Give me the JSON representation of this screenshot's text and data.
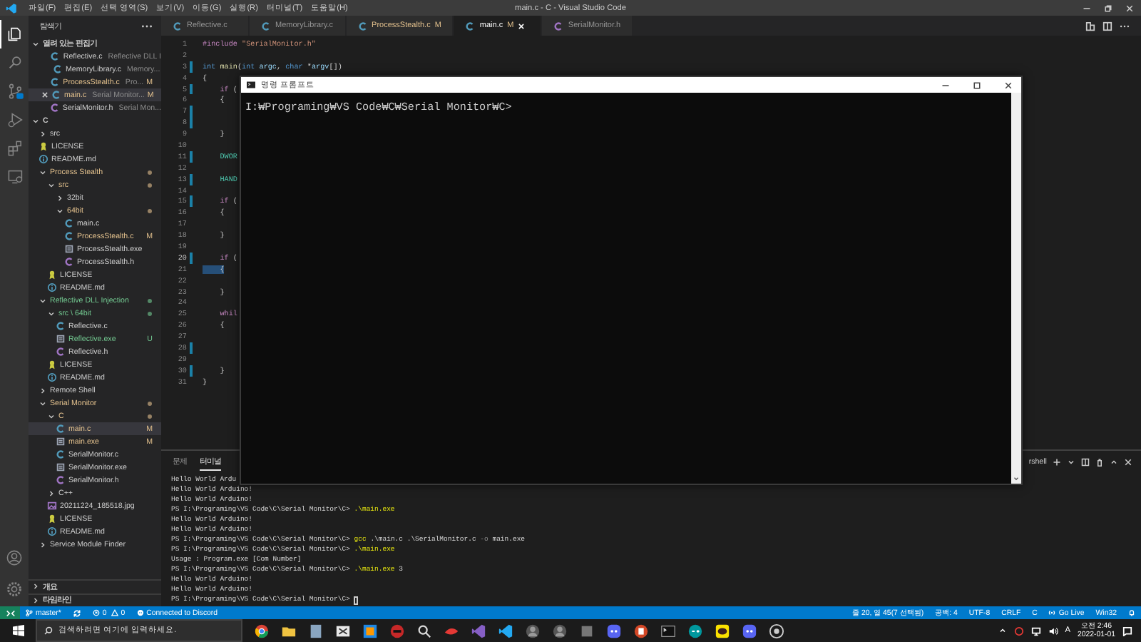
{
  "window": {
    "title": "main.c - C - Visual Studio Code",
    "menu": [
      "파일(F)",
      "편집(E)",
      "선택 영역(S)",
      "보기(V)",
      "이동(G)",
      "실행(R)",
      "터미널(T)",
      "도움말(H)"
    ]
  },
  "activity_bar": [
    {
      "selected": true
    },
    {
      "selected": false
    },
    {
      "selected": false
    },
    {
      "selected": false
    },
    {
      "selected": false
    },
    {
      "selected": false
    }
  ],
  "sidebar": {
    "title": "탐색기",
    "open_editors": {
      "title": "열려 있는 편집기",
      "expanded": true,
      "items": [
        {
          "name": "Reflective.c",
          "kind": "c",
          "description": "Reflective DLL I",
          "selected": false
        },
        {
          "name": "MemoryLibrary.c",
          "kind": "c",
          "description": "Memory...",
          "selected": false
        },
        {
          "name": "ProcessStealth.c",
          "kind": "c",
          "description": "Pro...",
          "badge": "M",
          "modified": true,
          "selected": false
        },
        {
          "name": "main.c",
          "kind": "c",
          "description": "Serial Monitor...",
          "badge": "M",
          "modified": true,
          "selected": true
        },
        {
          "name": "SerialMonitor.h",
          "kind": "h",
          "description": "Serial Mon...",
          "selected": false
        }
      ]
    },
    "folder": {
      "title": "C",
      "expanded": true,
      "tree": [
        {
          "label": "src",
          "kind": "folder",
          "expanded": false,
          "selected": false
        },
        {
          "label": "LICENSE",
          "kind": "license",
          "selected": false
        },
        {
          "label": "README.md",
          "kind": "md",
          "selected": false
        },
        {
          "label": "Process Stealth",
          "kind": "folder",
          "expanded": true,
          "modified": true,
          "selected": false,
          "children": [
            {
              "label": "src",
              "kind": "folder",
              "expanded": true,
              "modified": true,
              "selected": false,
              "children": [
                {
                  "label": "32bit",
                  "kind": "folder",
                  "expanded": false,
                  "selected": false
                },
                {
                  "label": "64bit",
                  "kind": "folder",
                  "expanded": true,
                  "modified": true,
                  "selected": false,
                  "children": [
                    {
                      "label": "main.c",
                      "kind": "c",
                      "selected": false
                    },
                    {
                      "label": "ProcessStealth.c",
                      "kind": "c",
                      "modified": true,
                      "badge": "M",
                      "selected": false
                    },
                    {
                      "label": "ProcessStealth.exe",
                      "kind": "exe",
                      "selected": false
                    },
                    {
                      "label": "ProcessStealth.h",
                      "kind": "h",
                      "selected": false
                    }
                  ]
                }
              ]
            },
            {
              "label": "LICENSE",
              "kind": "license",
              "selected": false
            },
            {
              "label": "README.md",
              "kind": "md",
              "selected": false
            }
          ]
        },
        {
          "label": "Reflective DLL Injection",
          "kind": "folder",
          "expanded": true,
          "untracked": true,
          "selected": false,
          "children": [
            {
              "label": "src \\ 64bit",
              "kind": "folder",
              "expanded": true,
              "untracked": true,
              "selected": false,
              "children": [
                {
                  "label": "Reflective.c",
                  "kind": "c",
                  "selected": false
                },
                {
                  "label": "Reflective.exe",
                  "kind": "exe",
                  "untracked": true,
                  "badge": "U",
                  "selected": false
                },
                {
                  "label": "Reflective.h",
                  "kind": "h",
                  "selected": false
                }
              ]
            },
            {
              "label": "LICENSE",
              "kind": "license",
              "selected": false
            },
            {
              "label": "README.md",
              "kind": "md",
              "selected": false
            }
          ]
        },
        {
          "label": "Remote Shell",
          "kind": "folder",
          "expanded": false,
          "selected": false
        },
        {
          "label": "Serial Monitor",
          "kind": "folder",
          "expanded": true,
          "modified": true,
          "selected": false,
          "children": [
            {
              "label": "C",
              "kind": "folder",
              "expanded": true,
              "modified": true,
              "selected": false,
              "children": [
                {
                  "label": "main.c",
                  "kind": "c",
                  "modified": true,
                  "badge": "M",
                  "selected": true
                },
                {
                  "label": "main.exe",
                  "kind": "exe",
                  "modified": true,
                  "badge": "M",
                  "selected": false
                },
                {
                  "label": "SerialMonitor.c",
                  "kind": "c",
                  "selected": false
                },
                {
                  "label": "SerialMonitor.exe",
                  "kind": "exe",
                  "selected": false
                },
                {
                  "label": "SerialMonitor.h",
                  "kind": "h",
                  "selected": false
                }
              ]
            },
            {
              "label": "C++",
              "kind": "folder",
              "expanded": false,
              "selected": false
            },
            {
              "label": "20211224_185518.jpg",
              "kind": "jpg",
              "selected": false
            },
            {
              "label": "LICENSE",
              "kind": "license",
              "selected": false
            },
            {
              "label": "README.md",
              "kind": "md",
              "selected": false
            }
          ]
        },
        {
          "label": "Service Module Finder",
          "kind": "folder",
          "expanded": false,
          "selected": false
        }
      ]
    },
    "outline": {
      "title": "개요",
      "expanded": false
    },
    "timeline": {
      "title": "타임라인",
      "expanded": false
    }
  },
  "tabs": [
    {
      "name": "Reflective.c",
      "kind": "c",
      "selected": false
    },
    {
      "name": "MemoryLibrary.c",
      "kind": "c",
      "selected": false
    },
    {
      "name": "ProcessStealth.c",
      "kind": "c",
      "badge": "M",
      "modified": true,
      "selected": false
    },
    {
      "name": "main.c",
      "kind": "c",
      "badge": "M",
      "modified": true,
      "selected": true
    },
    {
      "name": "SerialMonitor.h",
      "kind": "h",
      "selected": false
    }
  ],
  "editor": {
    "lines": [
      {
        "number": "1",
        "tokens": [
          {
            "t": "#include",
            "kind": "directive"
          },
          {
            "t": " \"SerialMonitor.h\"",
            "kind": "string"
          }
        ]
      },
      {
        "number": "2"
      },
      {
        "number": "3",
        "changed": true,
        "tokens": [
          {
            "t": "int",
            "kind": "keyword"
          },
          {
            "t": " main",
            "kind": "function"
          },
          {
            "t": "("
          },
          {
            "t": "int",
            "kind": "keyword"
          },
          {
            "t": " argc",
            "kind": "param"
          },
          {
            "t": ", "
          },
          {
            "t": "char",
            "kind": "keyword"
          },
          {
            "t": " *"
          },
          {
            "t": "argv",
            "kind": "param"
          },
          {
            "t": "[])"
          }
        ]
      },
      {
        "number": "4",
        "tokens": [
          {
            "t": "{"
          }
        ]
      },
      {
        "number": "5",
        "changed": true,
        "tokens": [
          {
            "t": "    if",
            "kind": "control"
          },
          {
            "t": " ("
          }
        ]
      },
      {
        "number": "6",
        "tokens": [
          {
            "t": "    {"
          }
        ]
      },
      {
        "number": "7",
        "changed": true
      },
      {
        "number": "8",
        "changed": true
      },
      {
        "number": "9",
        "tokens": [
          {
            "t": "    }"
          }
        ]
      },
      {
        "number": "10"
      },
      {
        "number": "11",
        "changed": true,
        "tokens": [
          {
            "t": "    DWOR",
            "kind": "type"
          }
        ]
      },
      {
        "number": "12"
      },
      {
        "number": "13",
        "changed": true,
        "tokens": [
          {
            "t": "    HAND",
            "kind": "type"
          }
        ]
      },
      {
        "number": "14"
      },
      {
        "number": "15",
        "changed": true,
        "tokens": [
          {
            "t": "    if",
            "kind": "control"
          },
          {
            "t": " ("
          }
        ]
      },
      {
        "number": "16",
        "tokens": [
          {
            "t": "    {"
          }
        ]
      },
      {
        "number": "17"
      },
      {
        "number": "18",
        "tokens": [
          {
            "t": "    }"
          }
        ]
      },
      {
        "number": "19"
      },
      {
        "number": "20",
        "changed": true,
        "current": true,
        "tokens": [
          {
            "t": "    if",
            "kind": "control"
          },
          {
            "t": " ("
          }
        ]
      },
      {
        "number": "21",
        "selected": true,
        "tokens": [
          {
            "t": "    {"
          }
        ]
      },
      {
        "number": "22"
      },
      {
        "number": "23",
        "tokens": [
          {
            "t": "    }"
          }
        ]
      },
      {
        "number": "24"
      },
      {
        "number": "25",
        "tokens": [
          {
            "t": "    whil",
            "kind": "control"
          }
        ]
      },
      {
        "number": "26",
        "tokens": [
          {
            "t": "    {"
          }
        ]
      },
      {
        "number": "27"
      },
      {
        "number": "28",
        "changed": true
      },
      {
        "number": "29"
      },
      {
        "number": "30",
        "changed": true,
        "tokens": [
          {
            "t": "    }"
          }
        ]
      },
      {
        "number": "31",
        "tokens": [
          {
            "t": "}"
          }
        ]
      }
    ]
  },
  "panel": {
    "tabs": [
      {
        "label": "문제",
        "selected": false
      },
      {
        "label": "터미널",
        "selected": true
      }
    ],
    "shell": "rshell",
    "lines": [
      {
        "tokens": [
          {
            "t": "Hello World Ardu"
          }
        ]
      },
      {
        "tokens": [
          {
            "t": "Hello World Arduino!"
          }
        ]
      },
      {
        "tokens": [
          {
            "t": "Hello World Arduino!"
          }
        ]
      },
      {
        "tokens": [
          {
            "t": "PS I:\\Programing\\VS Code\\C\\Serial Monitor\\C> "
          },
          {
            "t": ".\\main.exe",
            "kind": "command"
          }
        ]
      },
      {
        "tokens": [
          {
            "t": "Hello World Arduino!"
          }
        ]
      },
      {
        "tokens": [
          {
            "t": "Hello World Arduino!"
          }
        ]
      },
      {
        "tokens": [
          {
            "t": "PS I:\\Programing\\VS Code\\C\\Serial Monitor\\C> "
          },
          {
            "t": "gcc",
            "kind": "command"
          },
          {
            "t": " .\\main.c .\\SerialMonitor.c "
          },
          {
            "t": "-o",
            "kind": "flag"
          },
          {
            "t": " main.exe"
          }
        ]
      },
      {
        "tokens": [
          {
            "t": "PS I:\\Programing\\VS Code\\C\\Serial Monitor\\C> "
          },
          {
            "t": ".\\main.exe",
            "kind": "command"
          }
        ]
      },
      {
        "tokens": [
          {
            "t": "Usage : Program.exe [Com Number]"
          }
        ]
      },
      {
        "tokens": [
          {
            "t": "PS I:\\Programing\\VS Code\\C\\Serial Monitor\\C> "
          },
          {
            "t": ".\\main.exe",
            "kind": "command"
          },
          {
            "t": " 3"
          }
        ]
      },
      {
        "tokens": [
          {
            "t": "Hello World Arduino!"
          }
        ]
      },
      {
        "tokens": [
          {
            "t": "Hello World Arduino!"
          }
        ]
      },
      {
        "tokens": [
          {
            "t": "PS I:\\Programing\\VS Code\\C\\Serial Monitor\\C> "
          }
        ],
        "cursor": true
      }
    ]
  },
  "cmd_window": {
    "title": "명령 프롬프트",
    "lines": [
      "I:₩Programing₩VS Code₩C₩Serial Monitor₩C>"
    ]
  },
  "status_bar": {
    "branch": "master*",
    "errors": "0",
    "warnings": "0",
    "discord": "Connected to Discord",
    "position": "줄 20, 열 45(7 선택됨)",
    "indent": "공백: 4",
    "encoding": "UTF-8",
    "eol": "CRLF",
    "language": "C",
    "live": "Go Live",
    "platform": "Win32"
  },
  "taskbar": {
    "placeholder": "검색하려면 여기에 입력하세요.",
    "ime": "A",
    "time": "오전 2:46",
    "date": "2022-01-01"
  }
}
